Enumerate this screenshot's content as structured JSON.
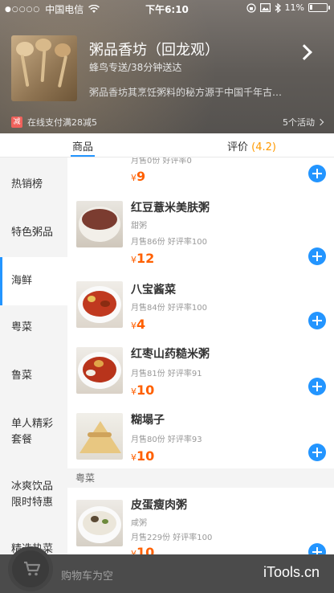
{
  "status_bar": {
    "carrier": "中国电信",
    "signal_dots": "●○○○○",
    "time": "下午6:10",
    "battery": "11%"
  },
  "shop": {
    "name": "粥品香坊（回龙观）",
    "delivery": "蜂鸟专送/38分钟送达",
    "description": "粥品香坊其烹饪粥料的秘方源于中国千年古…",
    "promo_badge": "减",
    "promo_text": "在线支付满28减5",
    "activity_count": "5个活动"
  },
  "tabs": {
    "goods": "商品",
    "reviews": "评价",
    "score": "(4.2)"
  },
  "sidebar": {
    "items": [
      {
        "label": "热销榜"
      },
      {
        "label": "特色粥品"
      },
      {
        "label": "海鲜"
      },
      {
        "label": "粤菜"
      },
      {
        "label": "鲁菜"
      },
      {
        "label": "单人精彩\n套餐"
      },
      {
        "label": "冰爽饮品\n限时特惠"
      },
      {
        "label": "精选热菜"
      }
    ],
    "active_index": 2
  },
  "products": {
    "partial_top": {
      "sales": "月售0份 好评率0",
      "price": "9"
    },
    "items": [
      {
        "name": "红豆薏米美肤粥",
        "desc": "甜粥",
        "sales": "月售86份 好评率100",
        "price": "12"
      },
      {
        "name": "八宝酱菜",
        "desc": "",
        "sales": "月售84份 好评率100",
        "price": "4"
      },
      {
        "name": "红枣山药糙米粥",
        "desc": "",
        "sales": "月售81份 好评率91",
        "price": "10"
      },
      {
        "name": "糊塌子",
        "desc": "",
        "sales": "月售80份 好评率93",
        "price": "10"
      }
    ],
    "section_label": "粤菜",
    "section_items": [
      {
        "name": "皮蛋瘦肉粥",
        "desc": "咸粥",
        "sales": "月售229份 好评率100",
        "price": "10"
      }
    ],
    "currency": "¥"
  },
  "cart": {
    "empty_text": "购物车为空",
    "watermark": "iTools.cn",
    "behind_text": "购物车为空 · 精选热菜"
  },
  "icons": {
    "wifi": "wifi-icon",
    "bluetooth": "bluetooth-icon",
    "cart": "cart-icon",
    "add": "plus-icon"
  },
  "colors": {
    "accent": "#2395ff",
    "price": "#ff6000",
    "score": "#ff9a00"
  }
}
